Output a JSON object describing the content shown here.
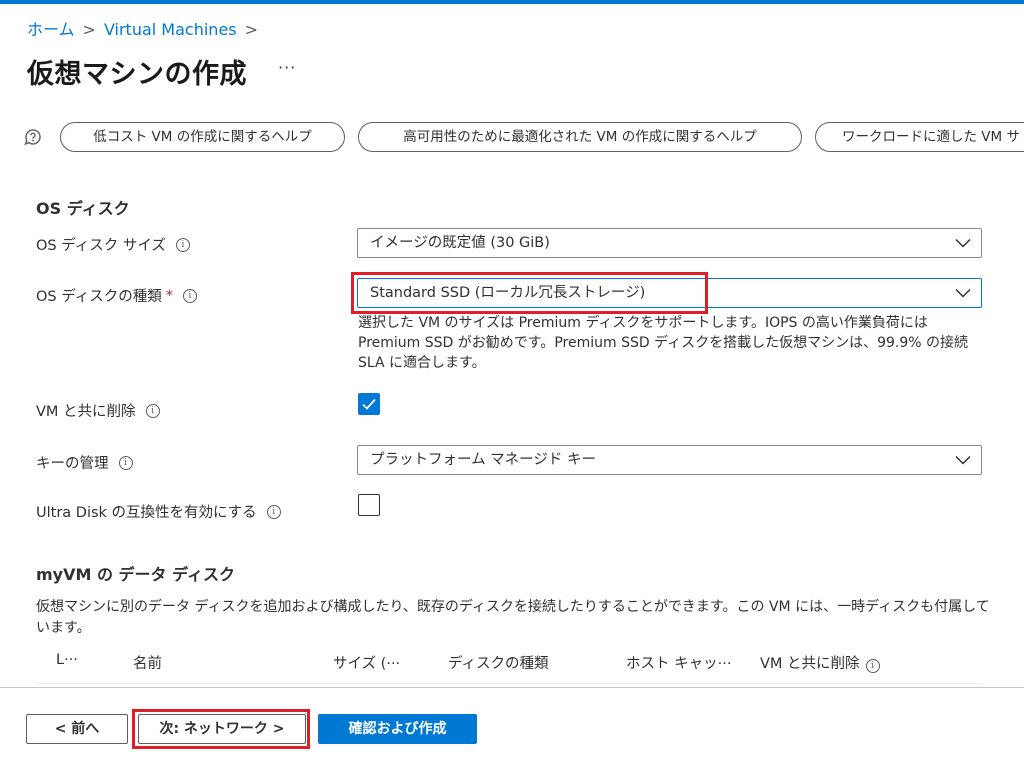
{
  "breadcrumb": {
    "home": "ホーム",
    "vm": "Virtual Machines",
    "sep": ">"
  },
  "page": {
    "title": "仮想マシンの作成",
    "more": "···"
  },
  "help_links": [
    "低コスト VM の作成に関するヘルプ",
    "高可用性のために最適化された VM の作成に関するヘルプ",
    "ワークロードに適した VM サ"
  ],
  "os_disk": {
    "section_title": "OS ディスク",
    "size_label": "OS ディスク サイズ",
    "size_value": "イメージの既定値 (30 GiB)",
    "type_label": "OS ディスクの種類",
    "type_required": "*",
    "type_value": "Standard SSD (ローカル冗長ストレージ)",
    "type_help": "選択した VM のサイズは Premium ディスクをサポートします。IOPS の高い作業負荷には Premium SSD がお勧めです。Premium SSD ディスクを搭載した仮想マシンは、99.9% の接続 SLA に適合します。",
    "delete_label": "VM と共に削除",
    "delete_checked": true,
    "key_label": "キーの管理",
    "key_value": "プラットフォーム マネージド キー",
    "ultra_label": "Ultra Disk の互換性を有効にする",
    "ultra_checked": false
  },
  "data_disks": {
    "section_title": "myVM の データ ディスク",
    "description": "仮想マシンに別のデータ ディスクを追加および構成したり、既存のディスクを接続したりすることができます。この VM には、一時ディスクも付属しています。",
    "columns": [
      "L···",
      "名前",
      "サイズ (···",
      "ディスクの種類",
      "ホスト キャッ···",
      "VM と共に削除"
    ]
  },
  "footer": {
    "prev": "< 前へ",
    "next": "次: ネットワーク >",
    "create": "確認および作成"
  },
  "colors": {
    "accent": "#0078d4",
    "highlight": "#e01e2a",
    "required": "#a4262c"
  },
  "icons": [
    "help-bubble-icon",
    "info-icon",
    "chevron-down-icon",
    "checkmark-icon"
  ]
}
